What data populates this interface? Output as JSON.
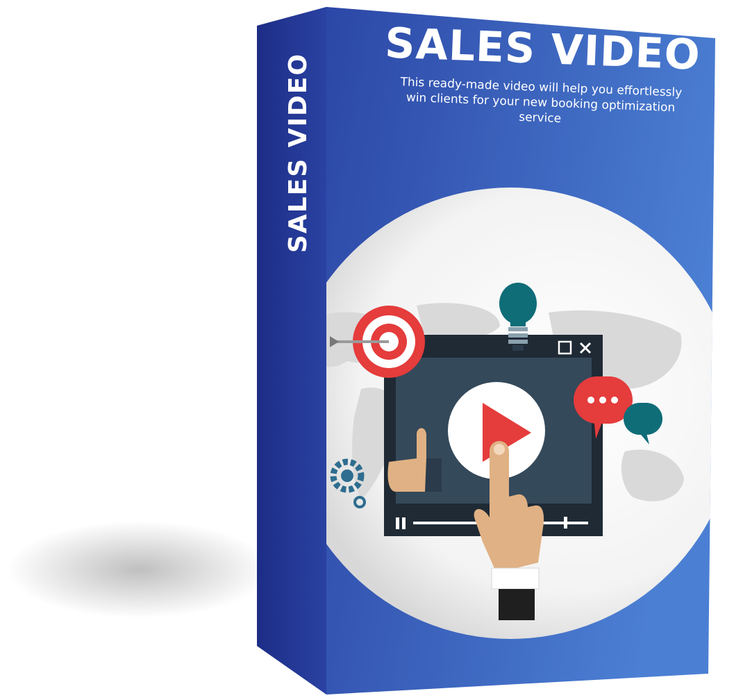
{
  "box": {
    "title": "SALES VIDEO",
    "subtitle": "This ready-made video will help you effortlessly win clients for your new booking optimization service",
    "spine_title": "SALES VIDEO"
  },
  "colors": {
    "front_blue_light": "#4a7bd1",
    "front_blue_dark": "#2b4aa8",
    "spine_blue": "#23379a",
    "accent_red": "#e53c3c",
    "teal": "#0f6d78",
    "screen_dark": "#1f2a35",
    "screen_panel": "#34495a",
    "skin": "#e0b184"
  },
  "icons": [
    "target-icon",
    "lightbulb-icon",
    "play-icon",
    "thumbs-up-icon",
    "chat-bubble-icon",
    "gear-icon",
    "pointing-hand-icon",
    "world-map-icon"
  ]
}
